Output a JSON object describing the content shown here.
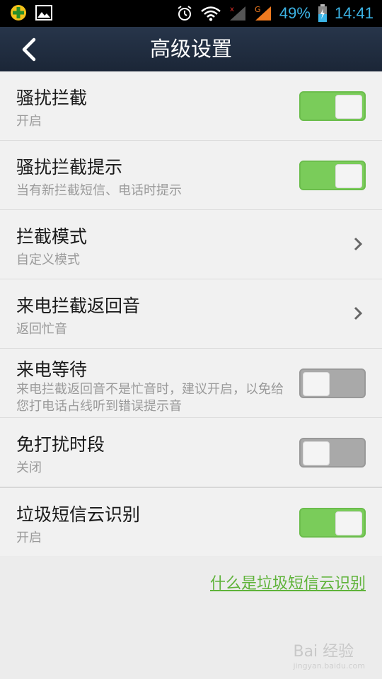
{
  "status_bar": {
    "battery": "49%",
    "time": "14:41",
    "left_icons": [
      "app-notification-icon",
      "image-notification-icon"
    ],
    "right_icons": [
      "alarm-icon",
      "wifi-icon",
      "signal-no-service-icon",
      "signal-g2-icon",
      "battery-charging-icon"
    ]
  },
  "header": {
    "title": "高级设置"
  },
  "settings": [
    {
      "title": "骚扰拦截",
      "subtitle": "开启",
      "control": "toggle",
      "on": true
    },
    {
      "title": "骚扰拦截提示",
      "subtitle": "当有新拦截短信、电话时提示",
      "control": "toggle",
      "on": true
    },
    {
      "title": "拦截模式",
      "subtitle": "自定义模式",
      "control": "chevron"
    },
    {
      "title": "来电拦截返回音",
      "subtitle": "返回忙音",
      "control": "chevron"
    },
    {
      "title": "来电等待",
      "subtitle": "来电拦截返回音不是忙音时，建议开启，以免给您打电话占线听到错误提示音",
      "control": "toggle",
      "on": false
    },
    {
      "title": "免打扰时段",
      "subtitle": "关闭",
      "control": "toggle",
      "on": false
    },
    {
      "title": "垃圾短信云识别",
      "subtitle": "开启",
      "control": "toggle",
      "on": true
    }
  ],
  "footer": {
    "link_text": "什么是垃圾短信云识别",
    "watermark": "Bai 经验",
    "watermark_sub": "jingyan.baidu.com"
  },
  "colors": {
    "accent_green": "#7acc5a",
    "toggle_off": "#a9a9a9",
    "header_bg": "#1f2b3d",
    "status_text": "#3cb4e6"
  }
}
